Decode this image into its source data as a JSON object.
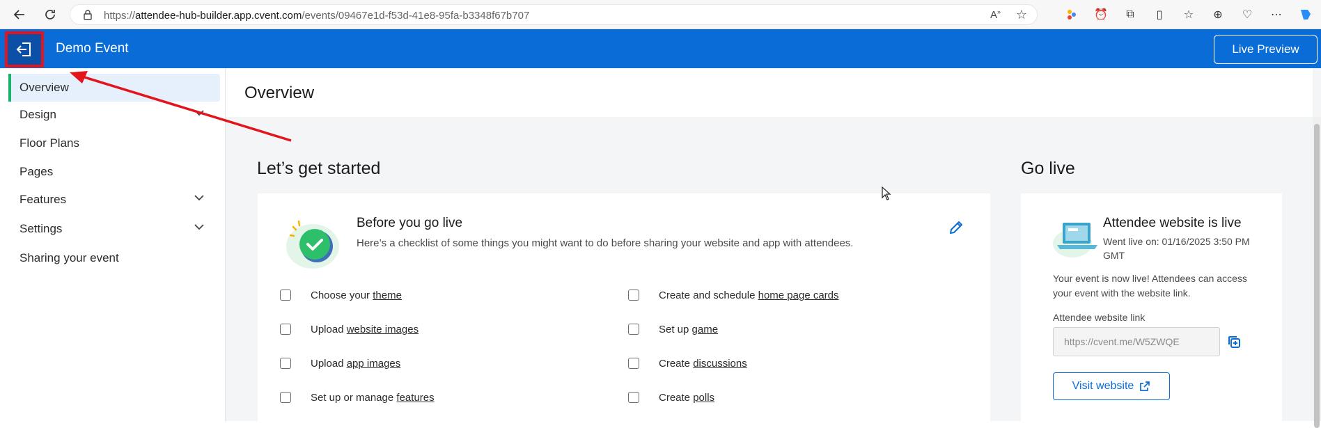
{
  "browser": {
    "url_prefix": "https://",
    "url_host": "attendee-hub-builder.app.cvent.com",
    "url_path": "/events/09467e1d-f53d-41e8-95fa-b3348f67b707"
  },
  "header": {
    "event_title": "Demo Event",
    "live_preview_label": "Live Preview"
  },
  "sidebar": {
    "items": [
      {
        "label": "Overview",
        "active": true
      },
      {
        "label": "Design",
        "has_chevron": true
      },
      {
        "label": "Floor Plans"
      },
      {
        "label": "Pages"
      },
      {
        "label": "Features",
        "has_chevron": true
      },
      {
        "label": "Settings",
        "has_chevron": true
      },
      {
        "label": "Sharing your event"
      }
    ]
  },
  "main": {
    "title": "Overview",
    "get_started": {
      "heading": "Let’s get started",
      "card_title": "Before you go live",
      "card_desc": "Here’s a checklist of some things you might want to do before sharing your website and app with attendees.",
      "left_items": [
        {
          "prefix": "Choose your ",
          "link": "theme"
        },
        {
          "prefix": "Upload ",
          "link": "website images"
        },
        {
          "prefix": "Upload ",
          "link": "app images"
        },
        {
          "prefix": "Set up or manage ",
          "link": "features"
        }
      ],
      "right_items": [
        {
          "prefix": "Create and schedule ",
          "link": "home page cards"
        },
        {
          "prefix": "Set up ",
          "link": "game"
        },
        {
          "prefix": "Create ",
          "link": "discussions"
        },
        {
          "prefix": "Create ",
          "link": "polls"
        }
      ]
    },
    "go_live": {
      "heading": "Go live",
      "status": "Attendee website is live",
      "went_live": "Went live on: 01/16/2025 3:50 PM GMT",
      "desc": "Your event is now live! Attendees can access your event with the website link.",
      "link_label": "Attendee website link",
      "link_value": "https://cvent.me/W5ZWQE",
      "visit_label": "Visit website"
    }
  },
  "colors": {
    "brand_blue": "#0a6cd6",
    "annotation_red": "#e3141b",
    "active_green": "#1bb36a"
  }
}
